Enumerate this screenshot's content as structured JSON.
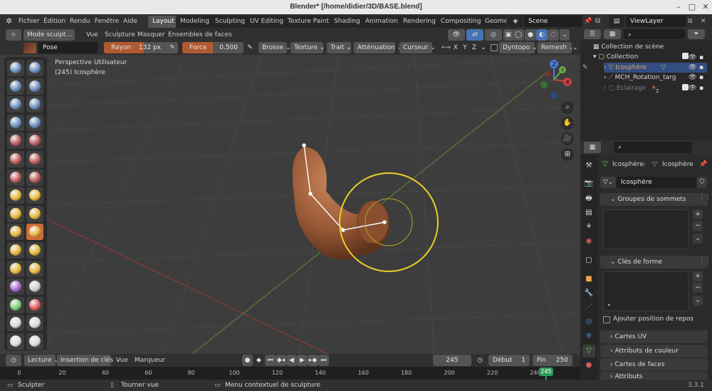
{
  "window": {
    "title": "Blender* [/home/didier/3D/BASE.blend]"
  },
  "menu": [
    "Fichier",
    "Édition",
    "Rendu",
    "Fenêtre",
    "Aide"
  ],
  "workspaces": [
    "Layout",
    "Modeling",
    "Sculpting",
    "UV Editing",
    "Texture Paint",
    "Shading",
    "Animation",
    "Rendering",
    "Compositing",
    "Geome"
  ],
  "scene": {
    "name": "Scene",
    "view_layer": "ViewLayer"
  },
  "viewport_header": {
    "mode": "Mode sculpt...",
    "items": [
      "Vue",
      "Sculpture",
      "Masquer",
      "Ensembles de faces"
    ]
  },
  "tool_settings": {
    "brush_name": "Pose",
    "radius_label": "Rayon",
    "radius_value": "132 px",
    "strength_label": "Force",
    "strength_value": "0.500",
    "dropdowns": [
      "Brosse",
      "Texture",
      "Trait",
      "Atténuation",
      "Curseur"
    ],
    "axes": [
      "X",
      "Y",
      "Z"
    ],
    "dyntopo": "Dyntopo",
    "remesh": "Remesh"
  },
  "viewport": {
    "line1": "Perspective Utilisateur",
    "line2": "(245) Icosphère"
  },
  "outliner": {
    "root": "Collection de scène",
    "items": [
      {
        "name": "Collection",
        "level": 1
      },
      {
        "name": "Icosphère",
        "level": 2,
        "active": true
      },
      {
        "name": "MCH_Rotation_targ",
        "level": 2
      },
      {
        "name": "Eclairage",
        "level": 1,
        "dim": true
      }
    ],
    "badge": "2"
  },
  "properties": {
    "breadcrumb": [
      "Icosphère",
      "Icosphère"
    ],
    "mesh_name": "Icosphère",
    "sections": [
      "Groupes de sommets",
      "Clés de forme"
    ],
    "checkbox_label": "Ajouter position de repos",
    "collapsed_sections": [
      "Cartes UV",
      "Attributs de couleur",
      "Cartes de faces",
      "Attributs"
    ]
  },
  "timeline": {
    "items": [
      "Lecture",
      "Insertion de clés",
      "Vue",
      "Marqueur"
    ],
    "current_frame": "245",
    "start_label": "Début",
    "start": "1",
    "end_label": "Fin",
    "end": "250",
    "ticks": [
      "0",
      "20",
      "40",
      "60",
      "80",
      "100",
      "120",
      "140",
      "160",
      "180",
      "200",
      "220",
      "240"
    ],
    "playhead": "245"
  },
  "statusbar": {
    "items": [
      "Sculpter",
      "Tourner vue",
      "Menu contextuel de sculpture"
    ],
    "version": "3.3.1"
  },
  "colors": {
    "accent": "#4772b3",
    "active_object": "#f0a54a",
    "brush_ring": "#e8d226",
    "slider": "#b05a32",
    "timeline_playhead": "#2a9c5a"
  }
}
